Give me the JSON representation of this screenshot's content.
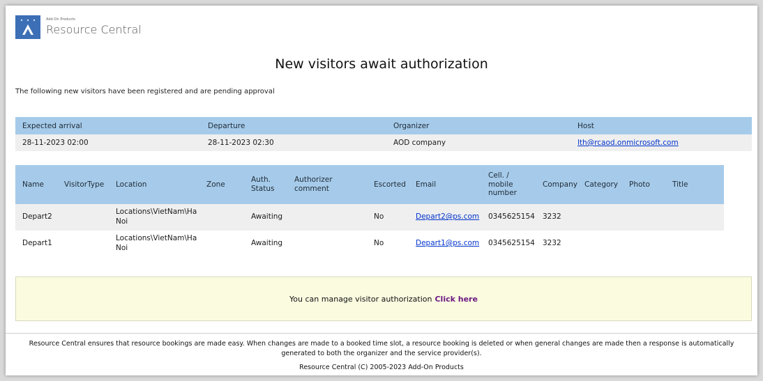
{
  "brand": {
    "small": "Add-On Products",
    "name": "Resource Central"
  },
  "page": {
    "title": "New visitors await authorization",
    "intro": "The following new visitors have been registered and are pending approval"
  },
  "summary": {
    "headers": [
      "Expected arrival",
      "Departure",
      "Organizer",
      "Host"
    ],
    "row": [
      "28-11-2023 02:00",
      "28-11-2023 02:30",
      "AOD company",
      "lth@rcaod.onmicrosoft.com"
    ]
  },
  "visitors": {
    "headers": [
      "Name",
      "VisitorType",
      "Location",
      "Zone",
      "Auth. Status",
      "Authorizer comment",
      "Escorted",
      "Email",
      "Cell. / mobile number",
      "Company",
      "Category",
      "Photo",
      "Title"
    ],
    "rows": [
      [
        "Depart2",
        "",
        "Locations\\VietNam\\Ha Noi",
        "",
        "Awaiting",
        "",
        "No",
        "Depart2@ps.com",
        "0345625154",
        "3232",
        "",
        "",
        ""
      ],
      [
        "Depart1",
        "",
        "Locations\\VietNam\\Ha Noi",
        "",
        "Awaiting",
        "",
        "No",
        "Depart1@ps.com",
        "0345625154",
        "3232",
        "",
        "",
        ""
      ]
    ]
  },
  "notice": {
    "text": "You can manage visitor authorization",
    "link": "Click here"
  },
  "footer": {
    "line1": "Resource Central ensures that resource bookings are made easy. When changes are made to a booked time slot, a resource booking is deleted or when general changes are made then a response is automatically generated to both the organizer and the service provider(s).",
    "line2": "Resource Central (C) 2005-2023 Add-On Products"
  }
}
